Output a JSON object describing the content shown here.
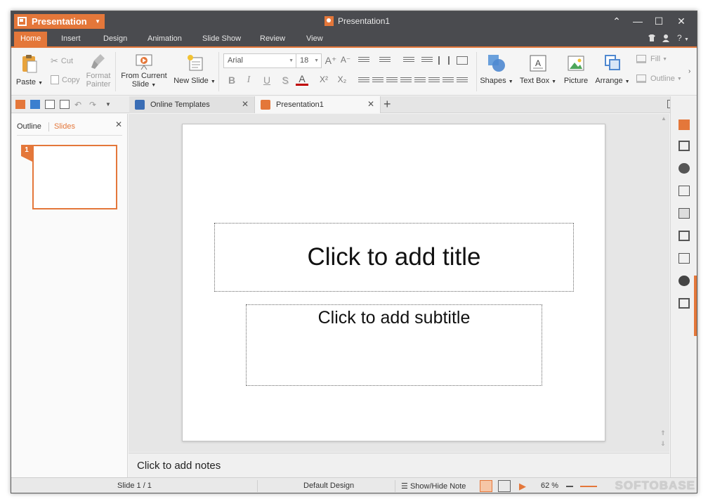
{
  "app": {
    "menu_label": "Presentation",
    "window_title": "Presentation1",
    "accent_color": "#e4773a",
    "titlebar_color": "#4a4b4f"
  },
  "window_controls": {
    "collapse": "⌃",
    "minimize": "—",
    "maximize": "☐",
    "close": "✕"
  },
  "menu": {
    "tabs": [
      "Home",
      "Insert",
      "Design",
      "Animation",
      "Slide Show",
      "Review",
      "View"
    ],
    "active": "Home",
    "help": "?"
  },
  "ribbon": {
    "paste": "Paste",
    "cut": "Cut",
    "copy": "Copy",
    "format_painter_1": "Format",
    "format_painter_2": "Painter",
    "from_current_slide_1": "From Current",
    "from_current_slide_2": "Slide",
    "new_slide": "New Slide",
    "font_name": "Arial",
    "font_size": "18",
    "bold": "B",
    "italic": "I",
    "underline": "U",
    "shadow": "S",
    "font_color": "A",
    "superscript": "X²",
    "subscript": "X₂",
    "grow_font": "A⁺",
    "shrink_font": "A⁻",
    "shapes": "Shapes",
    "text_box": "Text Box",
    "picture": "Picture",
    "arrange": "Arrange",
    "fill": "Fill",
    "outline": "Outline"
  },
  "doc_tabs": [
    {
      "label": "Online Templates"
    },
    {
      "label": "Presentation1"
    }
  ],
  "left_pane": {
    "tab_outline": "Outline",
    "tab_slides": "Slides",
    "slide_number": "1"
  },
  "slide": {
    "title_placeholder": "Click to add title",
    "subtitle_placeholder": "Click to add subtitle"
  },
  "notes": {
    "placeholder": "Click to add notes"
  },
  "status": {
    "slide_info": "Slide 1 / 1",
    "design": "Default Design",
    "notes_toggle": "Show/Hide Note",
    "zoom": "62 %"
  },
  "watermark": "SOFTOBASE"
}
